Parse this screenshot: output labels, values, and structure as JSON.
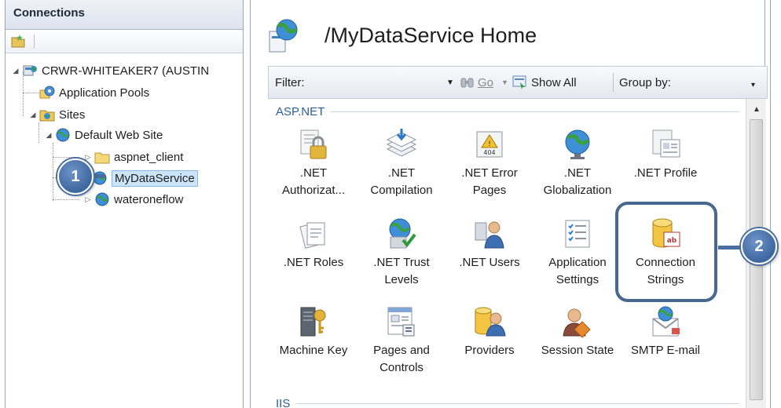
{
  "connections": {
    "title": "Connections",
    "tree": {
      "server": "CRWR-WHITEAKER7 (AUSTIN",
      "app_pools": "Application Pools",
      "sites": "Sites",
      "default_site": "Default Web Site",
      "aspnet_client": "aspnet_client",
      "mydataservice": "MyDataService",
      "wateroneflow": "wateroneflow"
    }
  },
  "main": {
    "title": "/MyDataService Home",
    "filter": {
      "label": "Filter:",
      "go": "Go",
      "show_all": "Show All",
      "group_by": "Group by:"
    },
    "groups": {
      "aspnet": "ASP.NET",
      "iis": "IIS"
    },
    "features": [
      {
        "line1": ".NET",
        "line2": "Authorizat...",
        "icon": "authorization-lock-icon"
      },
      {
        "line1": ".NET",
        "line2": "Compilation",
        "icon": "compilation-stack-icon"
      },
      {
        "line1": ".NET Error",
        "line2": "Pages",
        "icon": "error-page-404-icon"
      },
      {
        "line1": ".NET",
        "line2": "Globalization",
        "icon": "globe-icon"
      },
      {
        "line1": ".NET Profile",
        "line2": "",
        "icon": "profile-icon"
      },
      {
        "line1": ".NET Roles",
        "line2": "",
        "icon": "roles-icon"
      },
      {
        "line1": ".NET Trust",
        "line2": "Levels",
        "icon": "trust-globe-check-icon"
      },
      {
        "line1": ".NET Users",
        "line2": "",
        "icon": "users-icon"
      },
      {
        "line1": "Application",
        "line2": "Settings",
        "icon": "settings-list-icon"
      },
      {
        "line1": "Connection",
        "line2": "Strings",
        "icon": "database-ab-icon"
      },
      {
        "line1": "Machine Key",
        "line2": "",
        "icon": "machine-key-icon"
      },
      {
        "line1": "Pages and",
        "line2": "Controls",
        "icon": "pages-controls-icon"
      },
      {
        "line1": "Providers",
        "line2": "",
        "icon": "providers-icon"
      },
      {
        "line1": "Session State",
        "line2": "",
        "icon": "session-state-icon"
      },
      {
        "line1": "SMTP E-mail",
        "line2": "",
        "icon": "smtp-mail-icon"
      }
    ]
  },
  "callouts": {
    "one": "1",
    "two": "2"
  },
  "colors": {
    "callout": "#4a6e9f",
    "group_heading": "#2a5f98",
    "selection": "#cce4f7"
  }
}
